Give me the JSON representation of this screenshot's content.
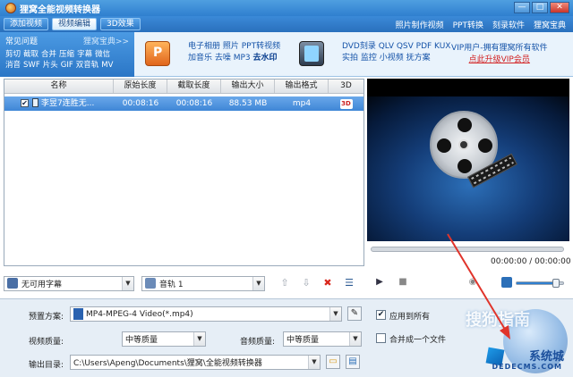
{
  "window": {
    "title": "狸窝全能视频转换器",
    "controls": {
      "minimize": "—",
      "maximize": "□",
      "close": "✕"
    }
  },
  "menubar": {
    "tabs": [
      {
        "label": "添加视频",
        "active": false
      },
      {
        "label": "视频编辑",
        "active": true
      },
      {
        "label": "3D效果",
        "active": false
      }
    ],
    "links": [
      "照片制作视频",
      "PPT转换",
      "刻录软件",
      "狸窝宝典"
    ]
  },
  "faq": {
    "title": "常见问题",
    "secret": "狸窝宝典>>",
    "row1": [
      "剪切",
      "截取",
      "合并",
      "压缩",
      "字幕",
      "微信"
    ],
    "row2": [
      "消音",
      "SWF",
      "片头",
      "GIF",
      "双音轨",
      "MV"
    ]
  },
  "promo": {
    "ppt_line1": "电子相册  照片  PPT转视频",
    "ppt_line2": "加音乐  去噪  MP3",
    "ppt_line2_hl": "去水印",
    "dvd_line1": "DVD刻录  QLV  QSV  PDF  KUX",
    "dvd_line2": "实拍  监控  小视频  抚方案",
    "vip_line1": "VIP用户-拥有狸窝所有软件",
    "vip_line2": "点此升级VIP会员",
    "icon_ppt": "ppt-icon",
    "icon_dvd": "phone-dvd-icon"
  },
  "file_list": {
    "columns": [
      "名称",
      "原始长度",
      "截取长度",
      "输出大小",
      "输出格式",
      "3D"
    ],
    "rows": [
      {
        "checked": "✔",
        "name": "李昱7连胜无...",
        "original_length": "00:08:16",
        "clip_length": "00:08:16",
        "output_size": "88.53 MB",
        "output_format": "mp4",
        "three_d": "3D"
      }
    ]
  },
  "list_toolbar": {
    "subtitle": "无可用字幕",
    "audio": "音轨 1",
    "up": "⇧",
    "down": "⇩",
    "delete": "✖",
    "list_icon": "☰"
  },
  "player": {
    "time": "00:00:00 / 00:00:00",
    "progress": 0,
    "volume": 0.85,
    "play": "▶",
    "stop": "■",
    "snapshot": "◉"
  },
  "settings": {
    "preset_label": "预置方案:",
    "preset_value": "MP4-MPEG-4 Video(*.mp4)",
    "apply_all_label": "应用到所有",
    "apply_all_checked": "✔",
    "video_quality_label": "视频质量:",
    "video_quality_value": "中等质量",
    "audio_quality_label": "音频质量:",
    "audio_quality_value": "中等质量",
    "merge_label": "合并成一个文件",
    "output_dir_label": "输出目录:",
    "output_dir_value": "C:\\Users\\Apeng\\Documents\\狸窝\\全能视频转换器",
    "tool_icon": "✎",
    "folder_icon": "▭",
    "open_icon": "▤"
  },
  "watermark": {
    "sogou": "搜狗指南",
    "site": "系统城",
    "url": "DEDECMS.COM"
  },
  "colors": {
    "accent": "#3b8ad8",
    "selected_row": "#4f93dc",
    "annotation_arrow": "#e0342b",
    "vip_link": "#d21f1f"
  }
}
